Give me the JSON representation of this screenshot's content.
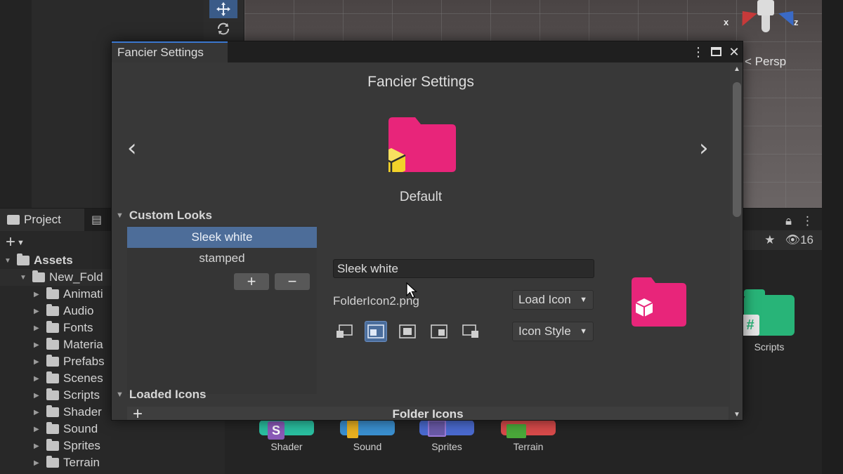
{
  "scene": {
    "persp_label": "< Persp",
    "gizmo_x": "x",
    "gizmo_z": "z"
  },
  "project": {
    "tab_label": "Project",
    "add_label": "+",
    "tree": [
      {
        "label": "Assets"
      },
      {
        "label": "New_Fold"
      },
      {
        "label": "Animati"
      },
      {
        "label": "Audio"
      },
      {
        "label": "Fonts"
      },
      {
        "label": "Materia"
      },
      {
        "label": "Prefabs"
      },
      {
        "label": "Scenes"
      },
      {
        "label": "Scripts"
      },
      {
        "label": "Shader"
      },
      {
        "label": "Sound"
      },
      {
        "label": "Sprites"
      },
      {
        "label": "Terrain"
      }
    ],
    "visible_count": "16"
  },
  "assets": {
    "tiles": [
      {
        "label": "Scripts",
        "color": "#28b478",
        "glyph": "#"
      },
      {
        "label": "Shader",
        "color": "#2abfa0",
        "glyph": "S"
      },
      {
        "label": "Sound",
        "color": "#3a8fd0",
        "glyph": ""
      },
      {
        "label": "Sprites",
        "color": "#4a6ad0",
        "glyph": ""
      },
      {
        "label": "Terrain",
        "color": "#d84a4a",
        "glyph": ""
      }
    ]
  },
  "window": {
    "tab_title": "Fancier Settings",
    "heading": "Fancier Settings",
    "preview_label": "Default",
    "preview_color": "#e8257a",
    "badge_color": "#f2d22a",
    "custom_looks_title": "Custom Looks",
    "looks": [
      "Sleek white",
      "stamped"
    ],
    "selected_look": "Sleek white",
    "add_btn": "+",
    "remove_btn": "−",
    "name_value": "Sleek white",
    "file_name": "FolderIcon2.png",
    "load_icon_label": "Load Icon",
    "icon_style_label": "Icon Style",
    "loaded_icons_title": "Loaded Icons",
    "folder_icons_label": "Folder Icons",
    "loaded_add": "+"
  }
}
